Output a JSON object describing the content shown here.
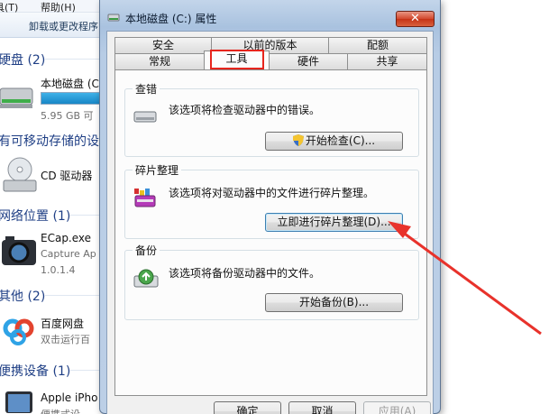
{
  "explorer": {
    "menu": {
      "tools": "具(T)",
      "help": "帮助(H)"
    },
    "command": {
      "uninstall": "卸载或更改程序"
    },
    "groups": {
      "hard_disk": "硬盘 (2)",
      "removable": "有可移动存储的设",
      "network": "网络位置 (1)",
      "other": "其他 (2)",
      "portable": "便携设备 (1)"
    },
    "items": {
      "local_disk_name": "本地磁盘 (C",
      "local_disk_free": "5.95 GB 可",
      "local_disk_used_fraction": 0.84,
      "cd_drive": "CD 驱动器",
      "ecap_name": "ECap.exe",
      "ecap_company": "Capture Ap",
      "ecap_version": "1.0.1.4",
      "baidu_name": "百度网盘",
      "baidu_sub": "双击运行百",
      "iphone_name": "Apple iPho",
      "iphone_sub": "便携式设"
    }
  },
  "dialog": {
    "title": "本地磁盘 (C:) 属性",
    "close_label": "✕",
    "tabs_row1": [
      "安全",
      "以前的版本",
      "配额"
    ],
    "tabs_row2": [
      "常规",
      "工具",
      "硬件",
      "共享"
    ],
    "active_tab": "工具",
    "check": {
      "label": "查错",
      "desc": "该选项将检查驱动器中的错误。",
      "button": "开始检查(C)..."
    },
    "defrag": {
      "label": "碎片整理",
      "desc": "该选项将对驱动器中的文件进行碎片整理。",
      "button": "立即进行碎片整理(D)..."
    },
    "backup": {
      "label": "备份",
      "desc": "该选项将备份驱动器中的文件。",
      "button": "开始备份(B)..."
    },
    "footer": {
      "ok": "确定",
      "cancel": "取消",
      "apply": "应用(A)"
    }
  },
  "colors": {
    "highlight": "#e6251d",
    "arrow": "#e8322b",
    "title_bar": "#b2c9e4"
  }
}
